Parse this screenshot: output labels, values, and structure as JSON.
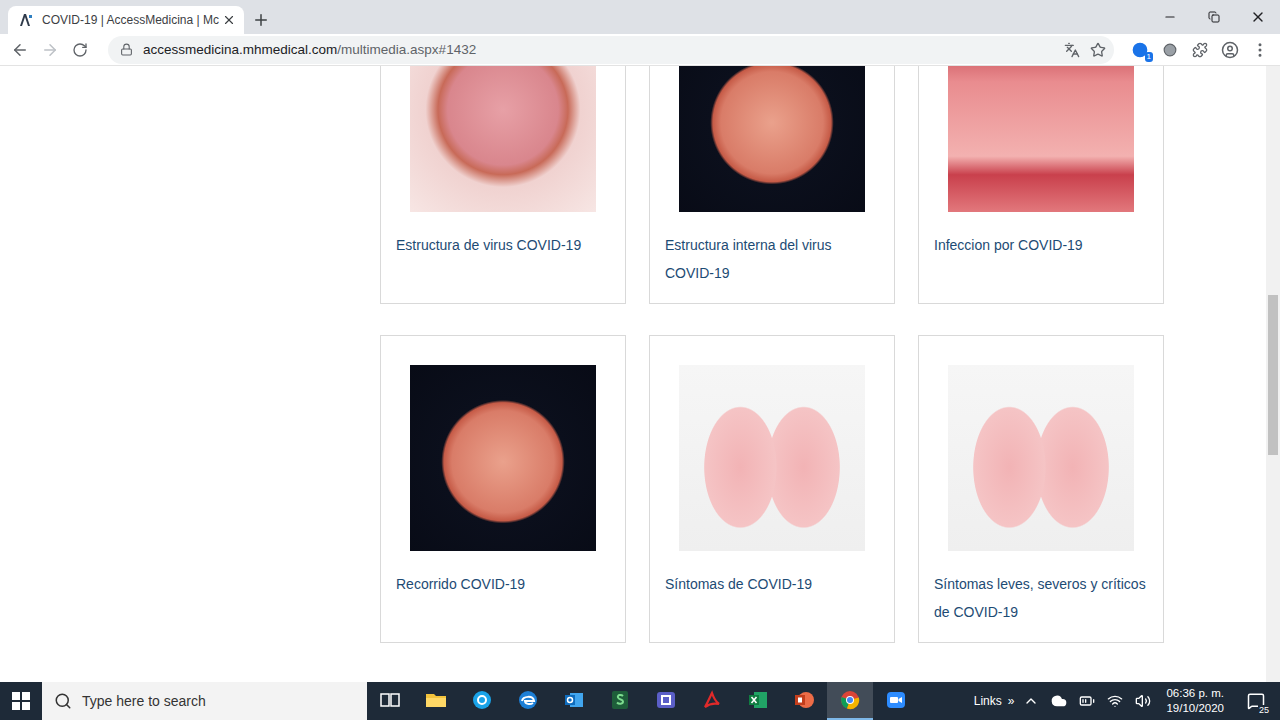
{
  "browser": {
    "tabs": [
      {
        "title": "COVID-19 | AccessMedicina | Mc",
        "selected": true
      }
    ],
    "url": {
      "domain": "accessmedicina.mhmedical.com",
      "path": "/multimedia.aspx#1432"
    },
    "extension_badge": "1"
  },
  "cards": [
    {
      "title": "Estructura de virus COVID-19",
      "kind": "virus-open"
    },
    {
      "title": "Estructura interna del virus COVID-19",
      "kind": "virus"
    },
    {
      "title": "Infeccion por COVID-19",
      "kind": "tissue"
    },
    {
      "title": "Recorrido COVID-19",
      "kind": "virus"
    },
    {
      "title": "Síntomas de COVID-19",
      "kind": "lungs"
    },
    {
      "title": "Síntomas leves, severos y críticos de COVID-19",
      "kind": "lungs"
    }
  ],
  "taskbar": {
    "search": {
      "placeholder": "Type here to search"
    },
    "apps": [
      {
        "kind": "task-view",
        "selected": false
      },
      {
        "kind": "explorer",
        "selected": false
      },
      {
        "kind": "skype",
        "selected": false
      },
      {
        "kind": "edge",
        "selected": false
      },
      {
        "kind": "outlook",
        "selected": false
      },
      {
        "kind": "sheets",
        "selected": false
      },
      {
        "kind": "teams",
        "selected": false
      },
      {
        "kind": "acrobat",
        "selected": false
      },
      {
        "kind": "excel",
        "selected": false
      },
      {
        "kind": "powerpoint",
        "selected": false
      },
      {
        "kind": "chrome",
        "selected": true
      },
      {
        "kind": "zoom",
        "selected": false
      }
    ],
    "toolbar": {
      "label": "Links",
      "more": "»"
    },
    "clock": {
      "time": "06:36 p. m.",
      "date": "19/10/2020"
    },
    "notifications": "25"
  }
}
